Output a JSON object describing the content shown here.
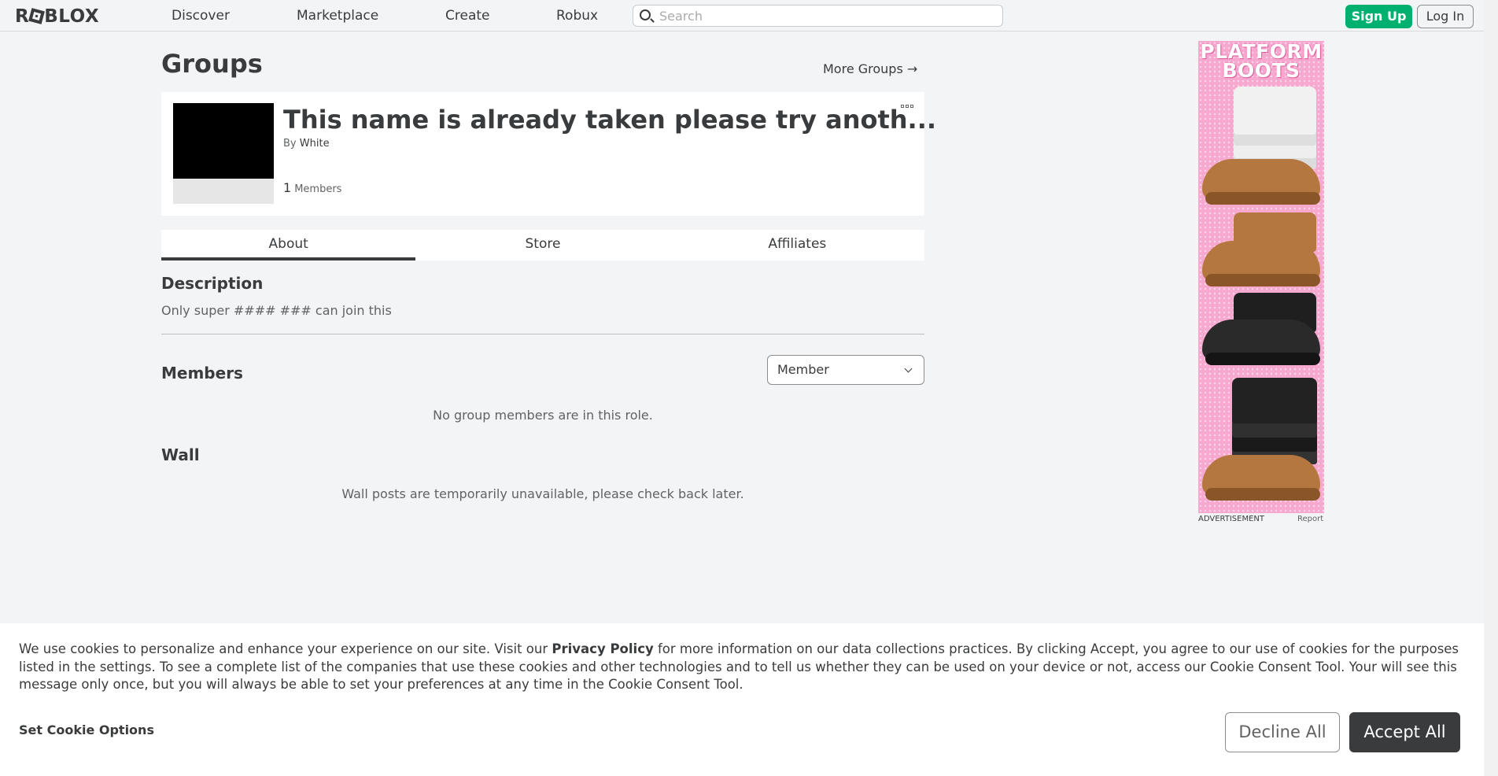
{
  "header": {
    "logo": "ROBLOX",
    "nav": [
      "Discover",
      "Marketplace",
      "Create",
      "Robux"
    ],
    "search_placeholder": "Search",
    "signup_label": "Sign Up",
    "login_label": "Log In"
  },
  "page": {
    "title": "Groups",
    "more_groups": "More Groups →"
  },
  "group": {
    "name": "This name is already taken please try anoth...",
    "by_label": "By",
    "owner": "White",
    "member_count": "1",
    "members_label": "Members"
  },
  "tabs": [
    "About",
    "Store",
    "Affiliates"
  ],
  "about": {
    "description_heading": "Description",
    "description": "Only super #### ### can join this",
    "members_heading": "Members",
    "role_selected": "Member",
    "no_members": "No group members are in this role.",
    "wall_heading": "Wall",
    "wall_message": "Wall posts are temporarily unavailable, please check back later."
  },
  "ad": {
    "headline_1": "PLATFORM",
    "headline_2": "BOOTS",
    "label": "ADVERTISEMENT",
    "report": "Report"
  },
  "cookie": {
    "text_before": "We use cookies to personalize and enhance your experience on our site. Visit our ",
    "privacy_link": "Privacy Policy",
    "text_after": " for more information on our data collections practices. By clicking Accept, you agree to our use of cookies for the purposes listed in the settings. To see a complete list of the companies that use these cookies and other technologies and to tell us whether they can be used on your device or not, access our Cookie Consent Tool. Your will see this message only once, but you will always be able to set your preferences at any time in the Cookie Consent Tool.",
    "set_options": "Set Cookie Options",
    "decline": "Decline All",
    "accept": "Accept All"
  },
  "colors": {
    "signup_green": "#00b06f",
    "text_dark": "#393b3d",
    "background": "#f2f4f5"
  }
}
